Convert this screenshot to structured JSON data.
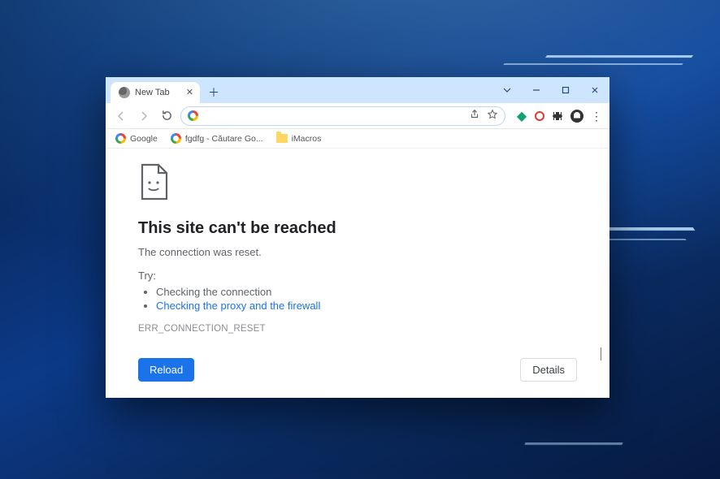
{
  "tab": {
    "title": "New Tab"
  },
  "omnibox": {
    "value": "",
    "placeholder": ""
  },
  "bookmarks": [
    {
      "label": "Google",
      "kind": "g"
    },
    {
      "label": "fgdfg - Căutare Go...",
      "kind": "g"
    },
    {
      "label": "iMacros",
      "kind": "folder"
    }
  ],
  "error": {
    "heading": "This site can't be reached",
    "subtitle": "The connection was reset.",
    "try_label": "Try:",
    "suggestions": [
      {
        "text": "Checking the connection",
        "link": false
      },
      {
        "text": "Checking the proxy and the firewall",
        "link": true
      }
    ],
    "code": "ERR_CONNECTION_RESET",
    "reload_label": "Reload",
    "details_label": "Details"
  }
}
